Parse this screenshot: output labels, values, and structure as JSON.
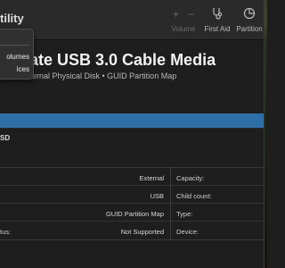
{
  "window": {
    "title_fragment": "tility"
  },
  "toolbar": {
    "volume_add": "+",
    "volume_remove": "−",
    "volume_label": "Volume",
    "first_aid_label": "First Aid",
    "partition_label": "Partition",
    "icons": {
      "volume": "plus-minus",
      "first_aid": "stethoscope",
      "partition": "pie-chart"
    }
  },
  "menu": {
    "items": [
      "olumes",
      "ices"
    ]
  },
  "disk": {
    "title": "ate USB 3.0 Cable Media",
    "subtitle": "ernal Physical Disk • GUID Partition Map"
  },
  "usage": {
    "accent": "#2f6fa8",
    "legend_name": "SD",
    "legend_size": ""
  },
  "info": {
    "rows": [
      {
        "left_label": "",
        "left_value": "External",
        "right_label": "Capacity:"
      },
      {
        "left_label": "",
        "left_value": "USB",
        "right_label": "Child count:"
      },
      {
        "left_label": "",
        "left_value": "GUID Partition Map",
        "right_label": "Type:"
      },
      {
        "left_label": "tus:",
        "left_value": "Not Supported",
        "right_label": "Device:"
      }
    ]
  }
}
